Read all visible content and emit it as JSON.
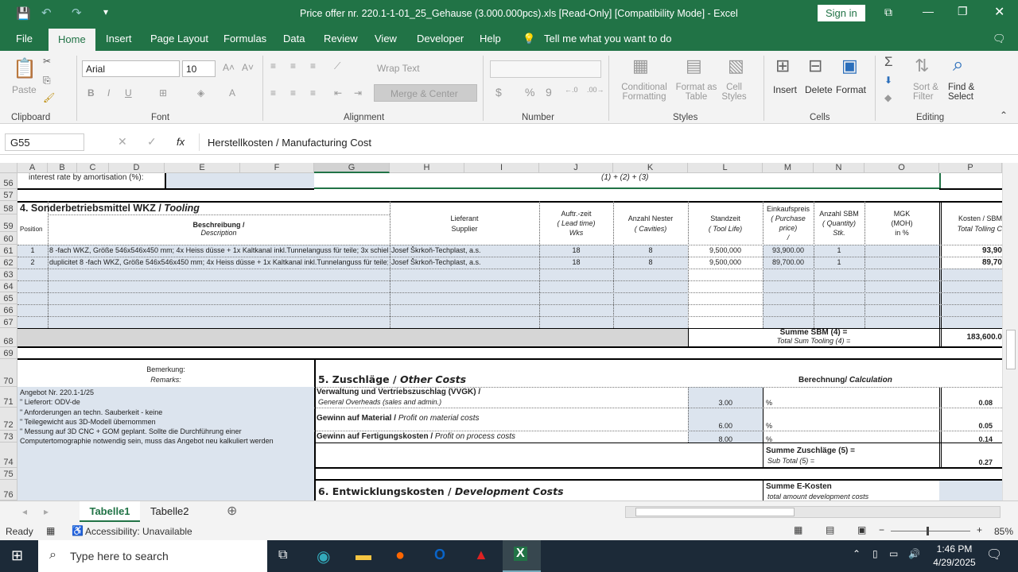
{
  "window": {
    "title": "Price offer nr. 220.1-1-01_25_Gehause (3.000.000pcs).xls  [Read-Only]  [Compatibility Mode]  -  Excel",
    "sign_in": "Sign in"
  },
  "menu": {
    "file": "File",
    "tabs": [
      "Home",
      "Insert",
      "Page Layout",
      "Formulas",
      "Data",
      "Review",
      "View",
      "Developer",
      "Help"
    ],
    "tell_me": "Tell me what you want to do"
  },
  "ribbon": {
    "paste": "Paste",
    "font_name": "Arial",
    "font_size": "10",
    "wrap_text": "Wrap Text",
    "merge_center": "Merge & Center",
    "conditional": "Conditional Formatting",
    "format_table": "Format as Table",
    "cell_styles": "Cell Styles",
    "insert": "Insert",
    "delete": "Delete",
    "format": "Format",
    "sort_filter": "Sort & Filter",
    "find_select": "Find & Select",
    "groups": [
      "Clipboard",
      "Font",
      "Alignment",
      "Number",
      "Styles",
      "Cells",
      "Editing"
    ]
  },
  "formula_bar": {
    "name_box": "G55",
    "fx": "fx",
    "content": "Herstellkosten / Manufacturing Cost"
  },
  "columns": [
    "A",
    "B",
    "C",
    "D",
    "E",
    "F",
    "G",
    "H",
    "I",
    "J",
    "K",
    "L",
    "M",
    "N",
    "O",
    "P"
  ],
  "rows": [
    "56",
    "57",
    "58",
    "59",
    "60",
    "61",
    "62",
    "63",
    "64",
    "65",
    "66",
    "67",
    "68",
    "69",
    "70",
    "71",
    "72",
    "73",
    "74",
    "75",
    "76"
  ],
  "sheet": {
    "r56_label": "interest rate by amortisation (%):",
    "r56_formula": "(1) + (2) + (3)",
    "tooling_title": "4. Sonderbetriebsmittel WKZ / ",
    "tooling_title_i": "Tooling",
    "h_position": "Position",
    "h_desc": "Beschreibung /",
    "h_desc_i": "Description",
    "h_supplier": "Lieferant",
    "h_supplier2": "Supplier",
    "h_lead": "Auftr.-zeit",
    "h_lead_i": "( Lead time)",
    "h_lead_u": "Wks",
    "h_cav": "Anzahl Nester",
    "h_cav_i": "( Cavities)",
    "h_life": "Standzeit",
    "h_life_i": "( Tool Life)",
    "h_price": "Einkaufspreis",
    "h_price_i": "( Purchase price)",
    "h_price_u": "/",
    "h_qty": "Anzahl SBM",
    "h_qty_i": "( Quantity)",
    "h_qty_u": "Stk.",
    "h_moh": "MGK",
    "h_moh2": "(MOH)",
    "h_moh3": "in %",
    "h_cost": "Kosten / SBM",
    "h_cost_i": "Total Tolling C",
    "items": [
      {
        "pos": "1",
        "desc": "8 -fach WKZ, Größe 546x546x450 mm; 4x Heiss düsse + 1x Kaltkanal inkl.Tunnelanguss für teile; 3x schieb",
        "supplier": "Josef Škrkoň-Techplast, a.s.",
        "lead": "18",
        "cav": "8",
        "life": "9,500,000",
        "price": "93,900.00",
        "qty": "1",
        "cost": "93,90"
      },
      {
        "pos": "2",
        "desc": "duplicitet 8 -fach WKZ, Größe 546x546x450 mm; 4x Heiss düsse + 1x Kaltkanal inkl.Tunnelanguss für teile;",
        "supplier": "Josef Škrkoň-Techplast, a.s.",
        "lead": "18",
        "cav": "8",
        "life": "9,500,000",
        "price": "89,700.00",
        "qty": "1",
        "cost": "89,70"
      }
    ],
    "sum_sbm": "Summe SBM (4) =",
    "sum_sbm_i": "Total Sum Tooling (4) =",
    "sum_sbm_val": "183,600.0",
    "remarks": "Bemerkung:",
    "remarks_i": "Remarks:",
    "remark_lines": [
      "Angebot Nr. 220.1-1/25",
      "\"   Lieferort:  ODV-de",
      "\"   Anforderungen an techn. Sauberkeit - keine",
      "\"  Teilegewicht aus 3D-Modell übernommen",
      "\"   Messung auf 3D CNC + GOM geplant. Sollte die Durchführung einer",
      "Computertomographie notwendig sein, muss das Angebot neu kalkuliert werden"
    ],
    "other_title": "5. Zuschläge / ",
    "other_title_i": "Other Costs",
    "calc": "Berechnung/ ",
    "calc_i": "Calculation",
    "vvgk": "Verwaltung und Vertriebszuschlag (VVGK) /",
    "vvgk_i": "General Overheads (sales and admin.)",
    "vvgk_pct": "3.00",
    "vvgk_val": "0.08",
    "gm": "Gewinn auf Material / ",
    "gm_i": "Profit on material costs",
    "gm_pct": "6.00",
    "gm_val": "0.05",
    "gf": "Gewinn auf Fertigungskosten / ",
    "gf_i": "Profit on process costs",
    "gf_pct": "8.00",
    "gf_val": "0.14",
    "pct": "%",
    "sum5": "Summe Zuschläge (5) =",
    "sum5_i": "Sub Total (5) =",
    "sum5_val": "0.27",
    "dev_title": "6. Entwicklungskosten / ",
    "dev_title_i": "Development Costs",
    "sum_e": "Summe E-Kosten",
    "sum_e_i": "total amount development costs"
  },
  "sheet_tabs": [
    "Tabelle1",
    "Tabelle2"
  ],
  "status": {
    "ready": "Ready",
    "accessibility": "Accessibility: Unavailable",
    "zoom": "85%"
  },
  "taskbar": {
    "search": "Type here to search",
    "time": "1:46 PM",
    "date": "4/29/2025"
  }
}
